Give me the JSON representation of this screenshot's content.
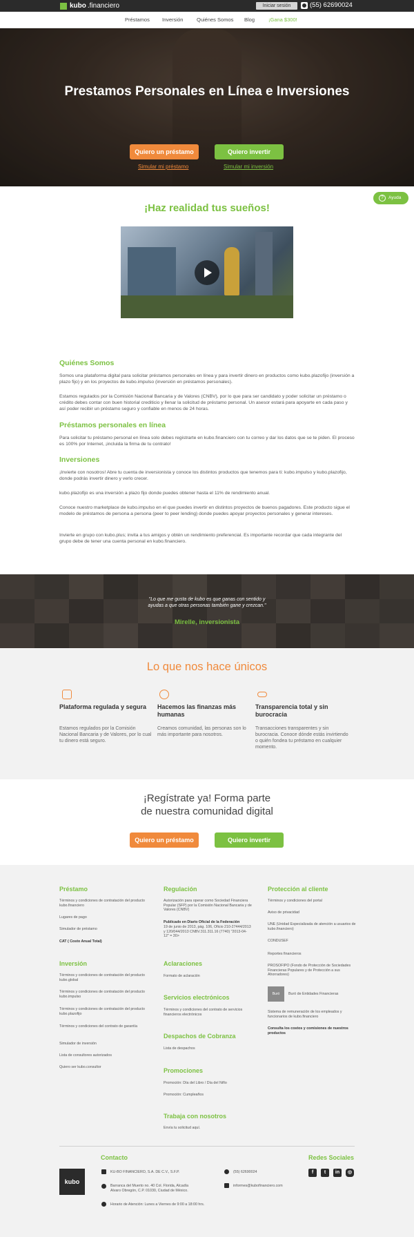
{
  "header": {
    "logo_bold": "kubo",
    "logo_text": ".financiero",
    "login_label": "Iniciar sesión",
    "phone": "(55) 62690024"
  },
  "nav": {
    "items": [
      "Préstamos",
      "Inversión",
      "Quiénes Somos",
      "Blog",
      "¡Gana $300!"
    ]
  },
  "hero": {
    "title": "Prestamos Personales en Línea e Inversiones",
    "loan_button": "Quiero un préstamo",
    "invest_button": "Quiero invertir",
    "loan_link": "Simular mi préstamo",
    "invest_link": "Simular mi inversión"
  },
  "help": {
    "label": "Ayuda",
    "icon": "question-icon"
  },
  "dreams": {
    "title": "¡Haz realidad tus sueños!"
  },
  "about": {
    "quienes_head": "Quiénes Somos",
    "quienes_p1": "Somos una plataforma digital para solicitar préstamos personales en línea y para invertir dinero en productos como kubo.plazofijo (inversión a plazo fijo) y en los proyectos de kubo.impulso (inversión en préstamos personales).",
    "quienes_p2": "Estamos regulados por la Comisión Nacional Bancaria y de Valores (CNBV), por lo que para ser candidato y poder solicitar un préstamo o crédito debes contar con buen historial crediticio y llenar la solicitud de préstamo personal. Un asesor estará para apoyarte en cada paso y así poder recibir un préstamo seguro y confiable en menos de 24 horas.",
    "prestamos_head": "Préstamos personales en línea",
    "prestamos_p": "Para solicitar tu préstamo personal en línea solo debes registrarte en kubo.financiero con tu correo y dar los datos que se te piden. El proceso es 100% por Internet, ¡incluida la firma de tu contrato!",
    "inversiones_head": "Inversiones",
    "inv_p1": "¡Invierte con nosotros! Abre tu cuenta de inversionista y conoce los distintos productos que tenemos para ti: kubo.impulso y kubo.plazofijo, donde podrás invertir dinero y verlo crecer.",
    "inv_p2": "kubo.plazofijo es una inversión a plazo fijo donde puedes obtener hasta el 11% de rendimiento anual.",
    "inv_p3": "Conoce nuestro marketplace de kubo.impulso en el que puedes invertir en distintos proyectos de buenos pagadores. Este producto sigue el modelo de préstamos de persona a persona (peer to peer lending) donde puedes apoyar proyectos personales y generar intereses.",
    "inv_p4": "Invierte en grupo con kubo.plus; invita a tus amigos y obtén un rendimiento preferencial. Es importante recordar que cada integrante del grupo debe de tener una cuenta personal en kubo.financiero."
  },
  "testimonial": {
    "quote": "\"Lo que me gusta de kubo es que ganas con sentido y ayudas a que otras personas también gane y crezcan.\"",
    "author": "Mirelle, inversionista"
  },
  "unique": {
    "title": "Lo que nos hace únicos",
    "features": [
      {
        "icon": "document-icon",
        "title": "Plataforma regulada y segura",
        "desc": "Estamos regulados por la Comisión Nacional Bancaria y de Valores, por lo cual tu dinero está seguro."
      },
      {
        "icon": "money-hand-icon",
        "title": "Hacemos las finanzas más humanas",
        "desc": "Creamos comunidad, las personas son lo más importante para nosotros."
      },
      {
        "icon": "glasses-icon",
        "title": "Transparencia total y sin burocracia",
        "desc": "Transacciones transparentes y sin burocracia. Conoce dónde estás invirtiendo o quién fondea tu préstamo en cualquier momento."
      }
    ]
  },
  "register": {
    "line1": "¡Regístrate ya! Forma parte",
    "line2": "de nuestra comunidad digital",
    "loan_button": "Quiero un préstamo",
    "invest_button": "Quiero invertir"
  },
  "footer": {
    "prestamo_head": "Préstamo",
    "prestamo_items": [
      "Términos y condiciones de contratación del producto kubo.financiero",
      "Lugares de pago",
      "Simulador de préstamo",
      "CAT ( Costo Anual Total)"
    ],
    "inversion_head": "Inversión",
    "inversion_items": [
      "Términos y condiciones de contratación del producto kubo.global",
      "Términos y condiciones de contratación del producto kubo.impulso",
      "Términos y condiciones de contratación del producto kubo.plazofijo",
      "Términos y condiciones del contrato de garantía",
      "Simulador de inversión",
      "Lista de consultores autorizados",
      "Quiero ser kubo.consultor"
    ],
    "regulacion_head": "Regulación",
    "regulacion_items": [
      "Autorización para operar como Sociedad Financiera Popular (SFP) por la Comisión Nacional Bancaria y de Valores (CNBV)",
      "Publicado en Diario Oficial de la Federación",
      "19 de junio de 2013, pág. 106, Oficio 210-27444/2013 y 120/044/2013 CNBV.311.311.16 (7740) \"2013-04-12\" = 30>"
    ],
    "aclaraciones_head": "Aclaraciones",
    "aclaraciones_items": [
      "Formato de aclaración"
    ],
    "servicios_head": "Servicios electrónicos",
    "servicios_items": [
      "Términos y condiciones del contrato de servicios financieros electrónicos"
    ],
    "despachos_head": "Despachos de Cobranza",
    "despachos_items": [
      "Lista de despachos"
    ],
    "promociones_head": "Promociones",
    "promociones_items": [
      "Promoción: Día del Libro / Día del Niño",
      "Promoción: Cumpleaños"
    ],
    "trabaja_head": "Trabaja con nosotros",
    "trabaja_items": [
      "Envía tu solicitud aquí."
    ],
    "proteccion_head": "Protección al cliente",
    "proteccion_items": [
      "Términos y condiciones del portal",
      "Aviso de privacidad",
      "UNE (Unidad Especializada de atención a usuarios de kubo.financiero)",
      "CONDUSEF",
      "Reportes financieros",
      "PROSOFIPO (Fondo de Protección de Sociedades Financieras Populares y de Protección a sus Ahorradores)",
      "Buró de Entidades Financieras",
      "Sistema de remuneración de los empleados y funcionarios de kubo.financiero",
      "Consulta los costos y comisiones de nuestros productos"
    ],
    "buro_logo": "Buró",
    "contacto_head": "Contacto",
    "company": "KU-BO FINANCIERO, S.A. DE C.V., S.F.P.",
    "address": "Barranca del Muerto no. 40 Col. Florida, Alcadía Alvaro Obregón, C.P. 01030, Ciudad de México.",
    "hours": "Horario de Atención: Lunes a Viernes de 9:00 a 18:00 hrs.",
    "phone": "(55) 62690024",
    "email": "informes@kubofinanciero.com",
    "kubo_logo": "kubo",
    "redes_head": "Redes Sociales",
    "social": [
      "facebook-icon",
      "twitter-icon",
      "linkedin-icon",
      "instagram-icon"
    ]
  },
  "colors": {
    "green": "#7cc142",
    "orange": "#f08a3c",
    "dark": "#2b2b2b"
  }
}
